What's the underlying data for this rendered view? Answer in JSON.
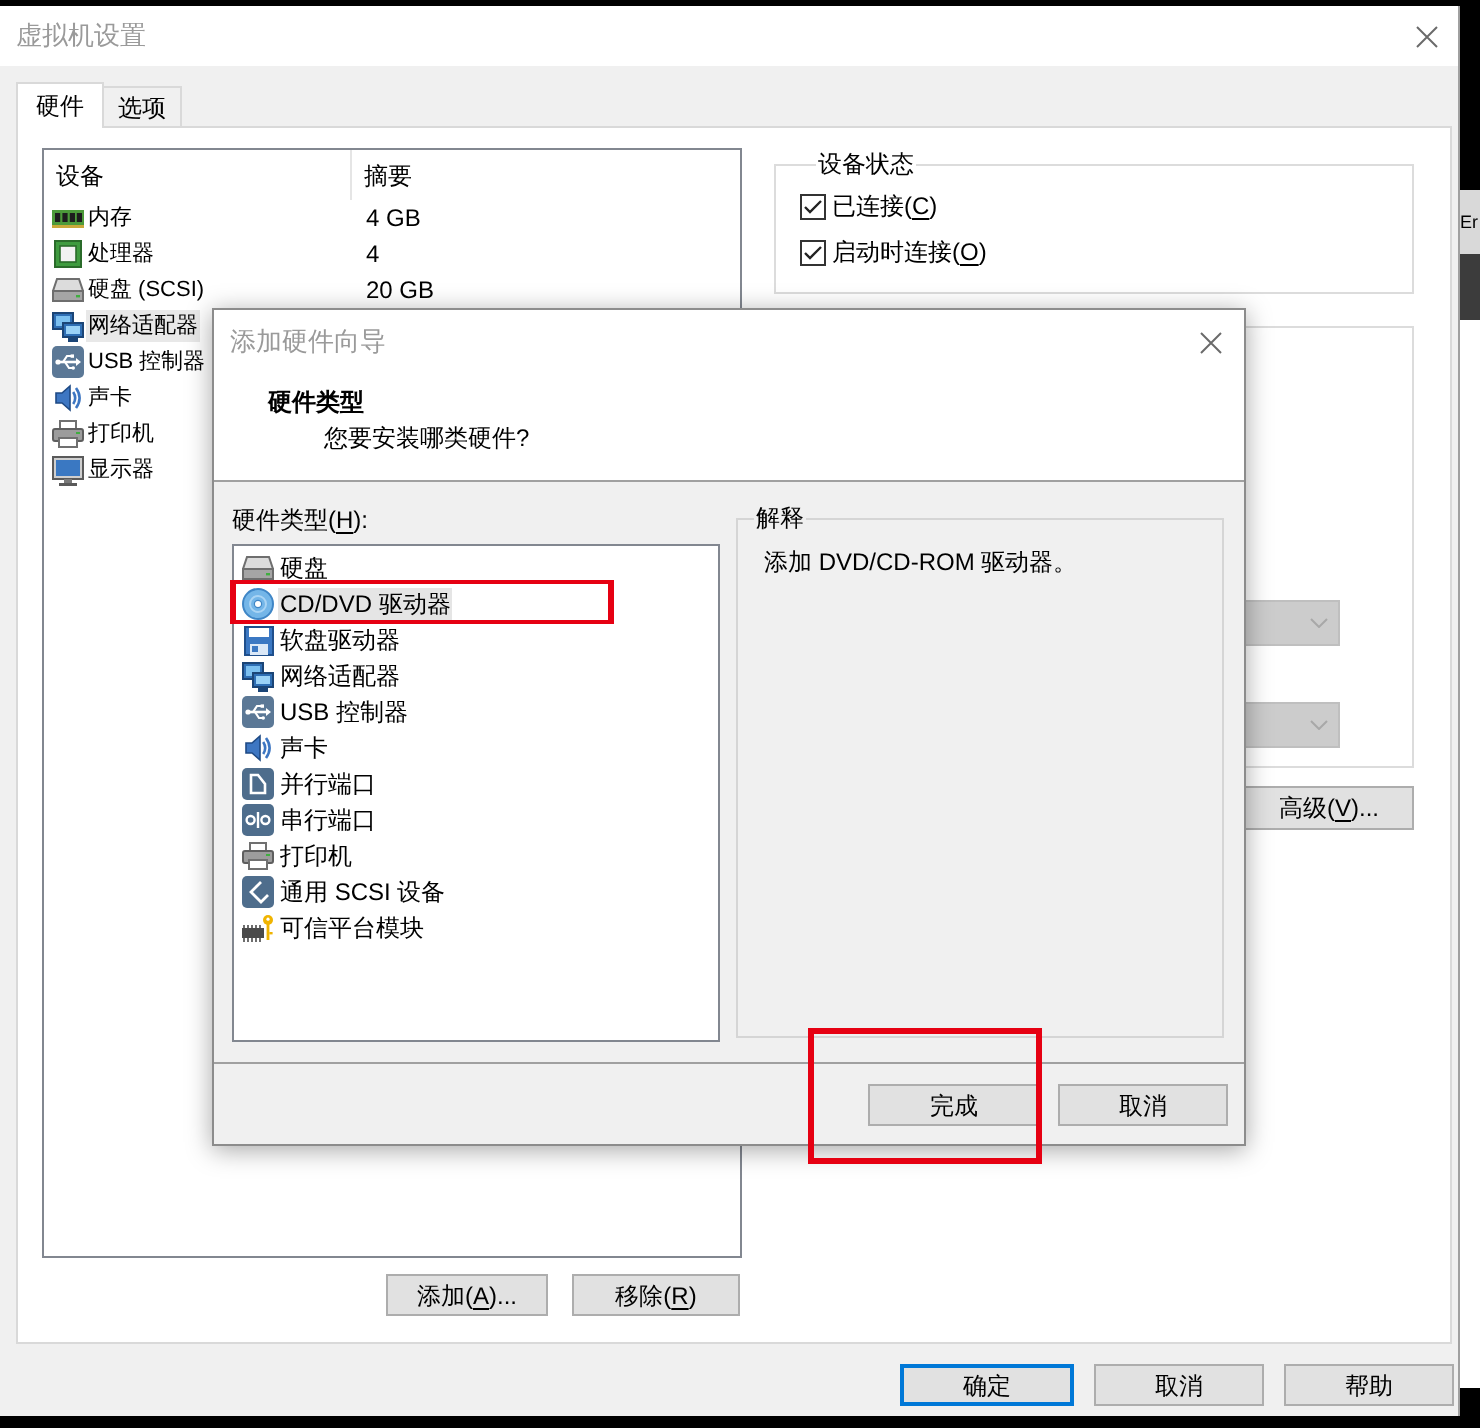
{
  "window": {
    "title": "虚拟机设置"
  },
  "tabs": [
    {
      "label": "硬件",
      "selected": true
    },
    {
      "label": "选项",
      "selected": false
    }
  ],
  "device_table": {
    "columns": [
      "设备",
      "摘要"
    ],
    "rows": [
      {
        "kind": "memory",
        "device": "内存",
        "summary": "4 GB",
        "selected": false
      },
      {
        "kind": "processor",
        "device": "处理器",
        "summary": "4",
        "selected": false
      },
      {
        "kind": "hard_disk",
        "device": "硬盘 (SCSI)",
        "summary": "20 GB",
        "selected": false
      },
      {
        "kind": "network",
        "device": "网络适配器",
        "selected": true
      },
      {
        "kind": "usb",
        "device": "USB 控制器",
        "selected": false
      },
      {
        "kind": "sound",
        "device": "声卡",
        "selected": false
      },
      {
        "kind": "printer",
        "device": "打印机",
        "selected": false
      },
      {
        "kind": "display",
        "device": "显示器",
        "selected": false
      }
    ]
  },
  "device_buttons": [
    {
      "text_before": "添加(",
      "access_key": "A",
      "text_after": ")..."
    },
    {
      "text_before": "移除(",
      "access_key": "R",
      "text_after": ")"
    }
  ],
  "device_status": {
    "title": "设备状态",
    "options": [
      {
        "text_before": "已连接(",
        "access_key": "C",
        "text_after": ")",
        "checked": true
      },
      {
        "text_before": "启动时连接(",
        "access_key": "O",
        "text_after": ")",
        "checked": true
      }
    ]
  },
  "connection": {
    "dropdowns": [
      {
        "disabled": true
      },
      {
        "disabled": true
      }
    ],
    "advanced_button": {
      "text_before": "高级(",
      "access_key": "V",
      "text_after": ")..."
    }
  },
  "wizard": {
    "title": "添加硬件向导",
    "heading": "硬件类型",
    "question": "您要安装哪类硬件?",
    "list_label": {
      "text_before": "硬件类型(",
      "access_key": "H",
      "text_after": "):"
    },
    "hardware_types": [
      {
        "kind": "hard_disk",
        "label": "硬盘",
        "selected": false,
        "annotated": false
      },
      {
        "kind": "optical",
        "label": "CD/DVD 驱动器",
        "selected": true,
        "annotated": true
      },
      {
        "kind": "floppy",
        "label": "软盘驱动器",
        "selected": false,
        "annotated": false
      },
      {
        "kind": "network",
        "label": "网络适配器",
        "selected": false,
        "annotated": false
      },
      {
        "kind": "usb",
        "label": "USB 控制器",
        "selected": false,
        "annotated": false
      },
      {
        "kind": "sound",
        "label": "声卡",
        "selected": false,
        "annotated": false
      },
      {
        "kind": "parallel",
        "label": "并行端口",
        "selected": false,
        "annotated": false
      },
      {
        "kind": "serial",
        "label": "串行端口",
        "selected": false,
        "annotated": false
      },
      {
        "kind": "printer",
        "label": "打印机",
        "selected": false,
        "annotated": false
      },
      {
        "kind": "scsi",
        "label": "通用 SCSI 设备",
        "selected": false,
        "annotated": false
      },
      {
        "kind": "tpm",
        "label": "可信平台模块",
        "selected": false,
        "annotated": false
      }
    ],
    "explanation": {
      "title": "解释",
      "text": "添加 DVD/CD-ROM 驱动器。"
    },
    "buttons": [
      {
        "label": "完成",
        "annotated": true
      },
      {
        "label": "取消",
        "annotated": false
      }
    ]
  },
  "buttons": [
    {
      "label": "确定",
      "focused": true
    },
    {
      "label": "取消",
      "focused": false
    },
    {
      "label": "帮助",
      "focused": false
    }
  ],
  "background_window": {
    "label": "Er"
  }
}
